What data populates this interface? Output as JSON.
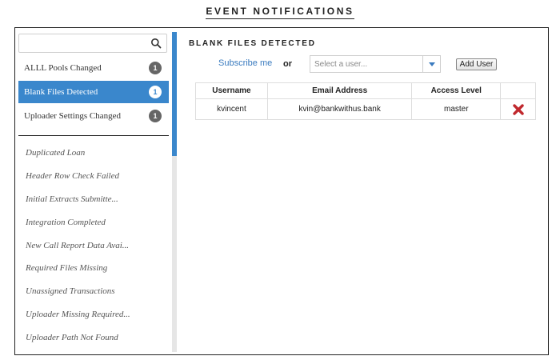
{
  "page": {
    "title": "EVENT NOTIFICATIONS"
  },
  "sidebar": {
    "search": {
      "value": "",
      "placeholder": ""
    },
    "subscribed": [
      {
        "label": "ALLL Pools Changed",
        "count": "1",
        "active": false
      },
      {
        "label": "Blank Files Detected",
        "count": "1",
        "active": true
      },
      {
        "label": "Uploader Settings Changed",
        "count": "1",
        "active": false
      }
    ],
    "events": [
      "Duplicated Loan",
      "Header Row Check Failed",
      "Initial Extracts Submitte...",
      "Integration Completed",
      "New Call Report Data Avai...",
      "Required Files Missing",
      "Unassigned Transactions",
      "Uploader Missing Required...",
      "Uploader Path Not Found"
    ]
  },
  "main": {
    "section_title": "BLANK FILES DETECTED",
    "subscribe_label": "Subscribe me",
    "or_label": "or",
    "user_select": {
      "placeholder": "Select a user..."
    },
    "add_user_label": "Add User",
    "table": {
      "columns": [
        "Username",
        "Email Address",
        "Access Level",
        ""
      ],
      "rows": [
        {
          "username": "kvincent",
          "email": "kvin@bankwithus.bank",
          "access": "master"
        }
      ]
    }
  },
  "colors": {
    "accent": "#3a87cc",
    "link": "#3a7bbf",
    "badge": "#666666",
    "delete": "#c0282d"
  },
  "icons": {
    "search": "search-icon",
    "dropdown": "chevron-down-icon",
    "delete": "delete-x-icon"
  }
}
